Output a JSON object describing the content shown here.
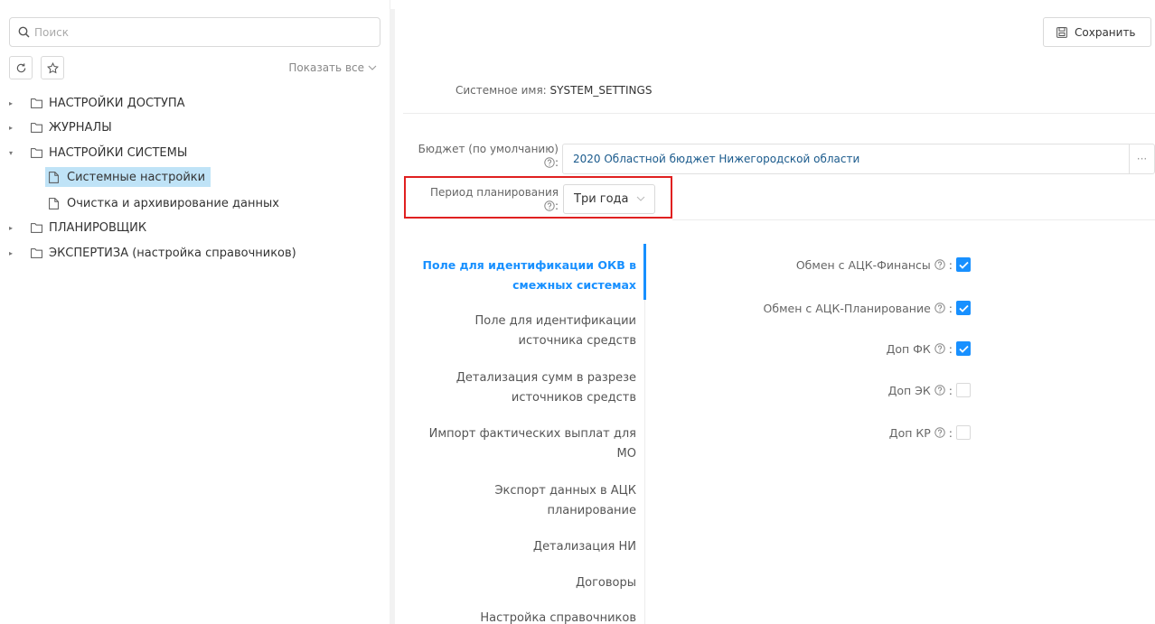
{
  "search": {
    "placeholder": "Поиск"
  },
  "toolbar": {
    "show_all": "Показать все"
  },
  "tree": [
    {
      "label": "НАСТРОЙКИ ДОСТУПА"
    },
    {
      "label": "ЖУРНАЛЫ"
    },
    {
      "label": "НАСТРОЙКИ СИСТЕМЫ"
    },
    {
      "label": "Системные настройки"
    },
    {
      "label": "Очистка и архивирование данных"
    },
    {
      "label": "ПЛАНИРОВЩИК"
    },
    {
      "label": "ЭКСПЕРТИЗА (настройка справочников)"
    }
  ],
  "header": {
    "save_label": "Сохранить"
  },
  "system_name": {
    "label": "Системное имя:",
    "value": "SYSTEM_SETTINGS"
  },
  "budget": {
    "label": "Бюджет (по умолчанию)",
    "value": "2020 Областной бюджет Нижегородской области",
    "more": "···"
  },
  "period": {
    "label": "Период планирования",
    "value": "Три года"
  },
  "vtabs": [
    {
      "line1": "Поле для идентификации ОКВ в",
      "line2": "смежных системах"
    },
    {
      "line1": "Поле для идентификации",
      "line2": "источника средств"
    },
    {
      "line1": "Детализация сумм в разрезе",
      "line2": "источников средств"
    },
    {
      "line1": "Импорт фактических выплат для",
      "line2": "МО"
    },
    {
      "line1": "Экспорт данных в АЦК",
      "line2": "планирование"
    },
    {
      "line1": "Детализация НИ"
    },
    {
      "line1": "Договоры"
    },
    {
      "line1": "Настройка справочников"
    }
  ],
  "options": [
    {
      "label": "Обмен с АЦК-Финансы",
      "checked": true
    },
    {
      "label": "Обмен с АЦК-Планирование",
      "checked": true
    },
    {
      "label": "Доп ФК",
      "checked": true
    },
    {
      "label": "Доп ЭК",
      "checked": false
    },
    {
      "label": "Доп КР",
      "checked": false
    }
  ],
  "colors": {
    "accent": "#1890ff",
    "selected_bg": "#bfe3f7",
    "highlight": "#e02020"
  }
}
